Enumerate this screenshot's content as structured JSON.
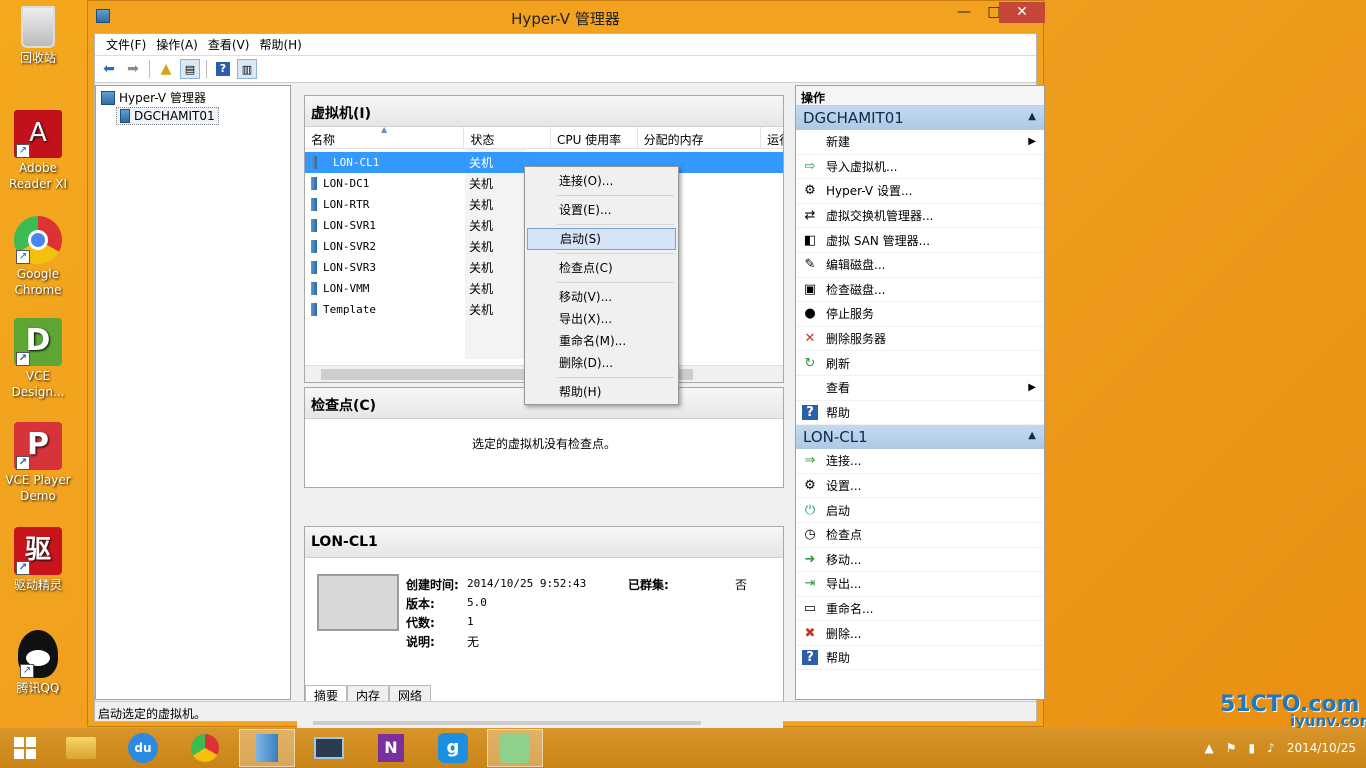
{
  "desktop": {
    "icons": [
      {
        "label": "回收站",
        "icon": "recycle-bin-icon"
      },
      {
        "label": "Adobe Reader XI",
        "icon": "adobe-reader-icon"
      },
      {
        "label": "Google Chrome",
        "icon": "chrome-icon"
      },
      {
        "label": "VCE Design...",
        "icon": "vce-designer-icon"
      },
      {
        "label": "VCE Player Demo",
        "icon": "vce-player-icon"
      },
      {
        "label": "驱动精灵",
        "icon": "driver-genius-icon"
      },
      {
        "label": "腾讯QQ",
        "icon": "qq-icon"
      }
    ]
  },
  "window": {
    "title": "Hyper-V 管理器",
    "controls": {
      "minimize": "—",
      "maximize": "□",
      "close": "✕"
    },
    "menu": [
      "文件(F)",
      "操作(A)",
      "查看(V)",
      "帮助(H)"
    ]
  },
  "tree": {
    "root": "Hyper-V 管理器",
    "server": "DGCHAMIT01"
  },
  "vm_panel": {
    "title": "虚拟机(I)",
    "columns": [
      "名称",
      "状态",
      "CPU 使用率",
      "分配的内存",
      "运行"
    ],
    "rows": [
      {
        "name": "LON-CL1",
        "state": "关机"
      },
      {
        "name": "LON-DC1",
        "state": "关机"
      },
      {
        "name": "LON-RTR",
        "state": "关机"
      },
      {
        "name": "LON-SVR1",
        "state": "关机"
      },
      {
        "name": "LON-SVR2",
        "state": "关机"
      },
      {
        "name": "LON-SVR3",
        "state": "关机"
      },
      {
        "name": "LON-VMM",
        "state": "关机"
      },
      {
        "name": "Template",
        "state": "关机"
      }
    ]
  },
  "context_menu": {
    "items": [
      "连接(O)...",
      "设置(E)...",
      "启动(S)",
      "检查点(C)",
      "移动(V)...",
      "导出(X)...",
      "重命名(M)...",
      "删除(D)...",
      "帮助(H)"
    ]
  },
  "checkpoint_panel": {
    "title": "检查点(C)",
    "empty_text": "选定的虚拟机没有检查点。"
  },
  "detail_panel": {
    "title": "LON-CL1",
    "created_label": "创建时间:",
    "created_value": "2014/10/25 9:52:43",
    "clustered_label": "已群集:",
    "clustered_value": "否",
    "version_label": "版本:",
    "version_value": "5.0",
    "generation_label": "代数:",
    "generation_value": "1",
    "notes_label": "说明:",
    "notes_value": "无",
    "tabs": [
      "摘要",
      "内存",
      "网络"
    ]
  },
  "actions": {
    "title": "操作",
    "server_section": "DGCHAMIT01",
    "server_items": [
      {
        "label": "新建",
        "icon": "blank"
      },
      {
        "label": "导入虚拟机...",
        "icon": "import-icon"
      },
      {
        "label": "Hyper-V 设置...",
        "icon": "settings-icon"
      },
      {
        "label": "虚拟交换机管理器...",
        "icon": "switch-icon"
      },
      {
        "label": "虚拟 SAN 管理器...",
        "icon": "san-icon"
      },
      {
        "label": "编辑磁盘...",
        "icon": "edit-disk-icon"
      },
      {
        "label": "检查磁盘...",
        "icon": "inspect-disk-icon"
      },
      {
        "label": "停止服务",
        "icon": "stop-icon"
      },
      {
        "label": "删除服务器",
        "icon": "remove-icon"
      },
      {
        "label": "刷新",
        "icon": "refresh-icon"
      },
      {
        "label": "查看",
        "icon": "blank"
      },
      {
        "label": "帮助",
        "icon": "help-icon"
      }
    ],
    "vm_section": "LON-CL1",
    "vm_items": [
      {
        "label": "连接...",
        "icon": "connect-icon"
      },
      {
        "label": "设置...",
        "icon": "settings-icon"
      },
      {
        "label": "启动",
        "icon": "power-icon"
      },
      {
        "label": "检查点",
        "icon": "checkpoint-icon"
      },
      {
        "label": "移动...",
        "icon": "move-icon"
      },
      {
        "label": "导出...",
        "icon": "export-icon"
      },
      {
        "label": "重命名...",
        "icon": "rename-icon"
      },
      {
        "label": "删除...",
        "icon": "delete-icon"
      },
      {
        "label": "帮助",
        "icon": "help-icon"
      }
    ]
  },
  "statusbar": "启动选定的虚拟机。",
  "tray": {
    "date": "2014/10/25"
  },
  "watermark": {
    "line1": "51CTO.com",
    "line2": "iyunv.com"
  }
}
